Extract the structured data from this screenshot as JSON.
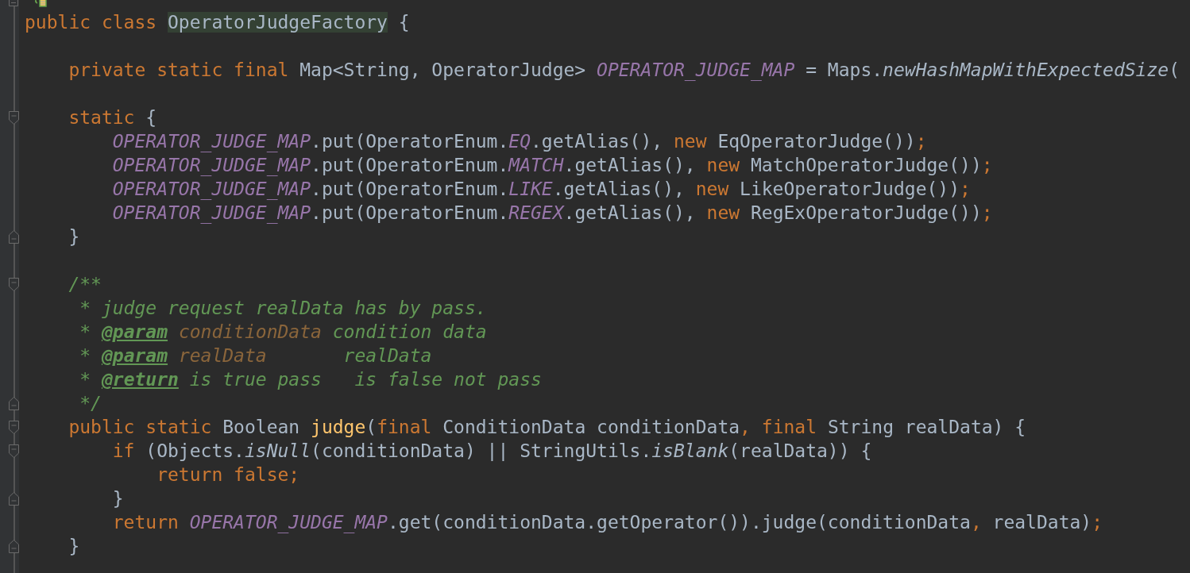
{
  "editor": {
    "lines": [
      {
        "fold_start": false,
        "fold_end": false,
        "tokens": [
          {
            "kind": "keyword",
            "text": "public class "
          },
          {
            "kind": "highlight",
            "text": "OperatorJudgeFactory"
          },
          {
            "kind": "plain",
            "text": " {"
          }
        ]
      },
      {
        "fold_start": false,
        "fold_end": false
      },
      {
        "fold_start": false,
        "fold_end": false,
        "tokens": [
          {
            "kind": "keyword",
            "text": "    private static final "
          },
          {
            "kind": "plain",
            "text": "Map<String, OperatorJudge> "
          },
          {
            "kind": "field",
            "text": "OPERATOR_JUDGE_MAP"
          },
          {
            "kind": "plain",
            "text": " = Maps."
          },
          {
            "kind": "static-call",
            "text": "newHashMapWithExpectedSize"
          },
          {
            "kind": "plain",
            "text": "("
          }
        ]
      },
      {
        "fold_start": false,
        "fold_end": false
      },
      {
        "fold_start": true,
        "fold_end": false,
        "tokens": [
          {
            "kind": "keyword",
            "text": "    static "
          },
          {
            "kind": "plain",
            "text": "{"
          }
        ]
      },
      {
        "fold_start": false,
        "fold_end": false,
        "tokens": [
          {
            "kind": "field",
            "text": "        OPERATOR_JUDGE_MAP"
          },
          {
            "kind": "plain",
            "text": ".put(OperatorEnum."
          },
          {
            "kind": "field",
            "text": "EQ"
          },
          {
            "kind": "plain",
            "text": ".getAlias(), "
          },
          {
            "kind": "keyword",
            "text": "new "
          },
          {
            "kind": "plain",
            "text": "EqOperatorJudge())"
          },
          {
            "kind": "keyword",
            "text": ";"
          }
        ]
      },
      {
        "fold_start": false,
        "fold_end": false,
        "tokens": [
          {
            "kind": "field",
            "text": "        OPERATOR_JUDGE_MAP"
          },
          {
            "kind": "plain",
            "text": ".put(OperatorEnum."
          },
          {
            "kind": "field",
            "text": "MATCH"
          },
          {
            "kind": "plain",
            "text": ".getAlias(), "
          },
          {
            "kind": "keyword",
            "text": "new "
          },
          {
            "kind": "plain",
            "text": "MatchOperatorJudge())"
          },
          {
            "kind": "keyword",
            "text": ";"
          }
        ]
      },
      {
        "fold_start": false,
        "fold_end": false,
        "tokens": [
          {
            "kind": "field",
            "text": "        OPERATOR_JUDGE_MAP"
          },
          {
            "kind": "plain",
            "text": ".put(OperatorEnum."
          },
          {
            "kind": "field",
            "text": "LIKE"
          },
          {
            "kind": "plain",
            "text": ".getAlias(), "
          },
          {
            "kind": "keyword",
            "text": "new "
          },
          {
            "kind": "plain",
            "text": "LikeOperatorJudge())"
          },
          {
            "kind": "keyword",
            "text": ";"
          }
        ]
      },
      {
        "fold_start": false,
        "fold_end": false,
        "tokens": [
          {
            "kind": "field",
            "text": "        OPERATOR_JUDGE_MAP"
          },
          {
            "kind": "plain",
            "text": ".put(OperatorEnum."
          },
          {
            "kind": "field",
            "text": "REGEX"
          },
          {
            "kind": "plain",
            "text": ".getAlias(), "
          },
          {
            "kind": "keyword",
            "text": "new "
          },
          {
            "kind": "plain",
            "text": "RegExOperatorJudge())"
          },
          {
            "kind": "keyword",
            "text": ";"
          }
        ]
      },
      {
        "fold_start": false,
        "fold_end": true,
        "tokens": [
          {
            "kind": "plain",
            "text": "    }"
          }
        ]
      },
      {
        "fold_start": false,
        "fold_end": false
      },
      {
        "fold_start": true,
        "fold_end": false,
        "tokens": [
          {
            "kind": "doc",
            "text": "    /**"
          }
        ]
      },
      {
        "fold_start": false,
        "fold_end": false,
        "tokens": [
          {
            "kind": "doc",
            "text": "     * judge request realData has by pass."
          }
        ]
      },
      {
        "fold_start": false,
        "fold_end": false,
        "tokens": [
          {
            "kind": "doc",
            "text": "     * "
          },
          {
            "kind": "doc-tag",
            "text": "@param"
          },
          {
            "kind": "doc-param",
            "text": " conditionData"
          },
          {
            "kind": "doc",
            "text": " condition data"
          }
        ]
      },
      {
        "fold_start": false,
        "fold_end": false,
        "tokens": [
          {
            "kind": "doc",
            "text": "     * "
          },
          {
            "kind": "doc-tag",
            "text": "@param"
          },
          {
            "kind": "doc-param",
            "text": " realData"
          },
          {
            "kind": "doc",
            "text": "       realData"
          }
        ]
      },
      {
        "fold_start": false,
        "fold_end": false,
        "tokens": [
          {
            "kind": "doc",
            "text": "     * "
          },
          {
            "kind": "doc-tag",
            "text": "@return"
          },
          {
            "kind": "doc",
            "text": " is true pass   is false not pass"
          }
        ]
      },
      {
        "fold_start": false,
        "fold_end": true,
        "tokens": [
          {
            "kind": "doc",
            "text": "     */"
          }
        ]
      },
      {
        "fold_start": true,
        "fold_end": false,
        "tokens": [
          {
            "kind": "keyword",
            "text": "    public static "
          },
          {
            "kind": "plain",
            "text": "Boolean "
          },
          {
            "kind": "method",
            "text": "judge"
          },
          {
            "kind": "plain",
            "text": "("
          },
          {
            "kind": "keyword",
            "text": "final "
          },
          {
            "kind": "plain",
            "text": "ConditionData conditionData"
          },
          {
            "kind": "keyword",
            "text": ", final "
          },
          {
            "kind": "plain",
            "text": "String realData) {"
          }
        ]
      },
      {
        "fold_start": true,
        "fold_end": false,
        "tokens": [
          {
            "kind": "keyword",
            "text": "        if "
          },
          {
            "kind": "plain",
            "text": "(Objects."
          },
          {
            "kind": "static-call",
            "text": "isNull"
          },
          {
            "kind": "plain",
            "text": "(conditionData) || StringUtils."
          },
          {
            "kind": "static-call",
            "text": "isBlank"
          },
          {
            "kind": "plain",
            "text": "(realData)) {"
          }
        ]
      },
      {
        "fold_start": false,
        "fold_end": false,
        "tokens": [
          {
            "kind": "keyword",
            "text": "            return false;"
          }
        ]
      },
      {
        "fold_start": false,
        "fold_end": true,
        "tokens": [
          {
            "kind": "plain",
            "text": "        }"
          }
        ]
      },
      {
        "fold_start": false,
        "fold_end": false,
        "tokens": [
          {
            "kind": "keyword",
            "text": "        return "
          },
          {
            "kind": "field",
            "text": "OPERATOR_JUDGE_MAP"
          },
          {
            "kind": "plain",
            "text": ".get(conditionData.getOperator()).judge(conditionData"
          },
          {
            "kind": "keyword",
            "text": ", "
          },
          {
            "kind": "plain",
            "text": "realData)"
          },
          {
            "kind": "keyword",
            "text": ";"
          }
        ]
      },
      {
        "fold_start": false,
        "fold_end": true,
        "tokens": [
          {
            "kind": "plain",
            "text": "    }"
          }
        ]
      }
    ]
  }
}
